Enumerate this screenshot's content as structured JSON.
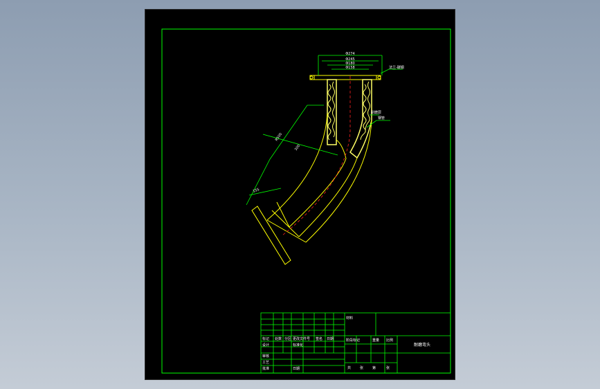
{
  "colors": {
    "background": "#000000",
    "frame": "#00ff00",
    "outline": "#ffff00",
    "lining": "#ffff66",
    "centerline": "#ff2020",
    "dimension": "#00ff00",
    "text": "#ffffff"
  },
  "dimensions": {
    "top1": "Φ274",
    "top2": "Φ245",
    "top3": "Φ180",
    "top4": "Φ158",
    "radius": "R500",
    "inner": "300",
    "bottom": "155"
  },
  "callouts": {
    "flange": "法兰-碳钢",
    "layer1": "耐磨层",
    "layer2": "钢管"
  },
  "title_block": {
    "row_mark": "标记",
    "row_count": "处数",
    "row_zone": "分区",
    "row_doc": "更改文件号",
    "row_sign": "签名",
    "row_design": "设计",
    "row_standard": "标准化",
    "row_check": "审核",
    "row_process": "工艺",
    "row_approve": "批准",
    "row_date": "日期",
    "material": "材料",
    "stage_mark": "阶段标记",
    "weight": "重量",
    "scale": "比例",
    "sheet_total": "共",
    "sheet_of": "张",
    "sheet_no": "第",
    "sheet_no2": "张",
    "drawing_title": "耐磨弯头"
  }
}
